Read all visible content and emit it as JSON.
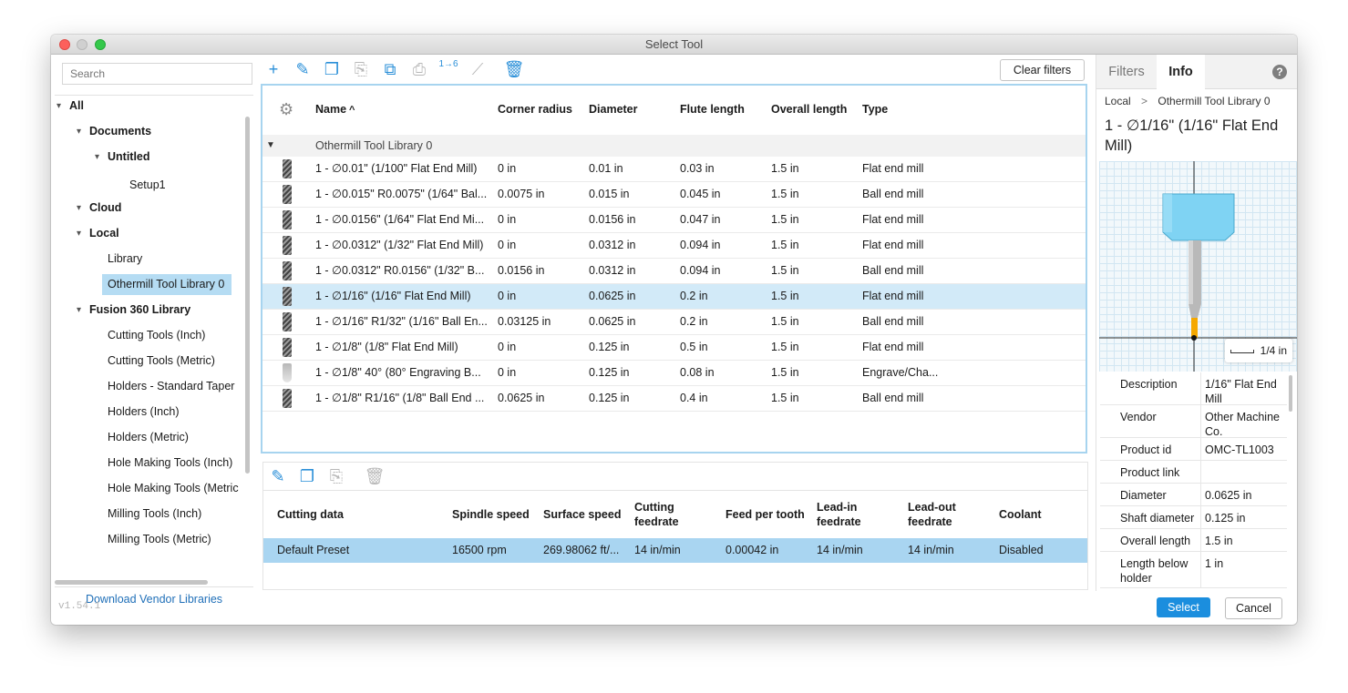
{
  "window": {
    "title": "Select Tool"
  },
  "sidebar": {
    "search_placeholder": "Search",
    "tree": [
      {
        "label": "All",
        "level": 0,
        "arrow": "▾",
        "bold": true
      },
      {
        "label": "Documents",
        "level": 1,
        "arrow": "▾",
        "bold": true
      },
      {
        "label": "Untitled",
        "level": 2,
        "arrow": "▾",
        "bold": true
      },
      {
        "label": "Setup1",
        "level": 3,
        "arrow": "",
        "bold": false
      },
      {
        "label": "Cloud",
        "level": 1,
        "arrow": "▾",
        "bold": true
      },
      {
        "label": "Local",
        "level": 1,
        "arrow": "▾",
        "bold": true
      },
      {
        "label": "Library",
        "level": 2,
        "arrow": "",
        "bold": false
      },
      {
        "label": "Othermill Tool Library 0",
        "level": 2,
        "arrow": "",
        "bold": false,
        "selected": true
      },
      {
        "label": "Fusion 360 Library",
        "level": 1,
        "arrow": "▾",
        "bold": true
      },
      {
        "label": "Cutting Tools (Inch)",
        "level": 2,
        "arrow": "",
        "bold": false
      },
      {
        "label": "Cutting Tools (Metric)",
        "level": 2,
        "arrow": "",
        "bold": false
      },
      {
        "label": "Holders - Standard Taper",
        "level": 2,
        "arrow": "",
        "bold": false
      },
      {
        "label": "Holders (Inch)",
        "level": 2,
        "arrow": "",
        "bold": false
      },
      {
        "label": "Holders (Metric)",
        "level": 2,
        "arrow": "",
        "bold": false
      },
      {
        "label": "Hole Making Tools (Inch)",
        "level": 2,
        "arrow": "",
        "bold": false
      },
      {
        "label": "Hole Making Tools (Metric",
        "level": 2,
        "arrow": "",
        "bold": false
      },
      {
        "label": "Milling Tools (Inch)",
        "level": 2,
        "arrow": "",
        "bold": false
      },
      {
        "label": "Milling Tools (Metric)",
        "level": 2,
        "arrow": "",
        "bold": false
      }
    ],
    "download_link": "Download Vendor Libraries",
    "version": "v1.54.1"
  },
  "toolbar": {
    "clear_filters": "Clear filters",
    "icons": [
      {
        "name": "add-icon",
        "glyph": "+",
        "enabled": true
      },
      {
        "name": "edit-icon",
        "glyph": "✎",
        "enabled": true
      },
      {
        "name": "copy-icon",
        "glyph": "❐",
        "enabled": true
      },
      {
        "name": "paste-icon",
        "glyph": "⎘",
        "enabled": false
      },
      {
        "name": "duplicate-icon",
        "glyph": "⧉",
        "enabled": true
      },
      {
        "name": "print-icon",
        "glyph": "⎙",
        "enabled": false
      },
      {
        "name": "renumber-icon",
        "glyph": "1→6",
        "enabled": true
      },
      {
        "name": "measure-icon",
        "glyph": "⟋",
        "enabled": false
      },
      {
        "name": "delete-icon",
        "glyph": "🗑",
        "enabled": true
      }
    ]
  },
  "tool_table": {
    "columns": [
      "Name",
      "Corner radius",
      "Diameter",
      "Flute length",
      "Overall length",
      "Type"
    ],
    "sort_indicator": "^",
    "group": "Othermill Tool Library 0",
    "rows": [
      {
        "icon": "flat",
        "name": "1 - ∅0.01\" (1/100\" Flat End Mill)",
        "corner_radius": "0 in",
        "diameter": "0.01 in",
        "flute_length": "0.03 in",
        "overall_length": "1.5 in",
        "type": "Flat end mill"
      },
      {
        "icon": "ball",
        "name": "1 - ∅0.015\" R0.0075\" (1/64\" Bal...",
        "corner_radius": "0.0075 in",
        "diameter": "0.015 in",
        "flute_length": "0.045 in",
        "overall_length": "1.5 in",
        "type": "Ball end mill"
      },
      {
        "icon": "flat",
        "name": "1 - ∅0.0156\" (1/64\" Flat End Mi...",
        "corner_radius": "0 in",
        "diameter": "0.0156 in",
        "flute_length": "0.047 in",
        "overall_length": "1.5 in",
        "type": "Flat end mill"
      },
      {
        "icon": "flat",
        "name": "1 - ∅0.0312\" (1/32\" Flat End Mill)",
        "corner_radius": "0 in",
        "diameter": "0.0312 in",
        "flute_length": "0.094 in",
        "overall_length": "1.5 in",
        "type": "Flat end mill"
      },
      {
        "icon": "ball",
        "name": "1 - ∅0.0312\" R0.0156\" (1/32\" B...",
        "corner_radius": "0.0156 in",
        "diameter": "0.0312 in",
        "flute_length": "0.094 in",
        "overall_length": "1.5 in",
        "type": "Ball end mill"
      },
      {
        "icon": "flat",
        "name": "1 - ∅1/16\" (1/16\" Flat End Mill)",
        "corner_radius": "0 in",
        "diameter": "0.0625 in",
        "flute_length": "0.2 in",
        "overall_length": "1.5 in",
        "type": "Flat end mill",
        "selected": true
      },
      {
        "icon": "ball",
        "name": "1 - ∅1/16\" R1/32\" (1/16\" Ball En...",
        "corner_radius": "0.03125 in",
        "diameter": "0.0625 in",
        "flute_length": "0.2 in",
        "overall_length": "1.5 in",
        "type": "Ball end mill"
      },
      {
        "icon": "flat",
        "name": "1 - ∅1/8\" (1/8\" Flat End Mill)",
        "corner_radius": "0 in",
        "diameter": "0.125 in",
        "flute_length": "0.5 in",
        "overall_length": "1.5 in",
        "type": "Flat end mill"
      },
      {
        "icon": "engrave",
        "name": "1 - ∅1/8\" 40° (80° Engraving B...",
        "corner_radius": "0 in",
        "diameter": "0.125 in",
        "flute_length": "0.08 in",
        "overall_length": "1.5 in",
        "type": "Engrave/Cha..."
      },
      {
        "icon": "ball",
        "name": "1 - ∅1/8\" R1/16\" (1/8\" Ball End ...",
        "corner_radius": "0.0625 in",
        "diameter": "0.125 in",
        "flute_length": "0.4 in",
        "overall_length": "1.5 in",
        "type": "Ball end mill"
      }
    ]
  },
  "cutting_toolbar": {
    "icons": [
      {
        "name": "edit-icon",
        "glyph": "✎",
        "enabled": true
      },
      {
        "name": "copy-icon",
        "glyph": "❐",
        "enabled": true
      },
      {
        "name": "paste-icon",
        "glyph": "⎘",
        "enabled": false
      },
      {
        "name": "delete-icon",
        "glyph": "🗑",
        "enabled": false
      }
    ]
  },
  "cutting_table": {
    "columns": [
      "Cutting data",
      "Spindle speed",
      "Surface speed",
      "Cutting\nfeedrate",
      "Feed per tooth",
      "Lead-in\nfeedrate",
      "Lead-out\nfeedrate",
      "Coolant"
    ],
    "rows": [
      {
        "cells": [
          "Default Preset",
          "16500 rpm",
          "269.98062 ft/...",
          "14 in/min",
          "0.00042 in",
          "14 in/min",
          "14 in/min",
          "Disabled"
        ]
      }
    ]
  },
  "info_panel": {
    "tabs": [
      "Filters",
      "Info"
    ],
    "active_tab": "Info",
    "help": "?",
    "breadcrumb": [
      "Local",
      "Othermill Tool Library 0"
    ],
    "breadcrumb_sep": ">",
    "title": "1 - ∅1/16\" (1/16\" Flat End Mill)",
    "scale_label": "1/4 in",
    "properties": [
      {
        "key": "Description",
        "value": "1/16\" Flat End Mill"
      },
      {
        "key": "Vendor",
        "value": "Other Machine Co."
      },
      {
        "key": "Product id",
        "value": "OMC-TL1003"
      },
      {
        "key": "Product link",
        "value": ""
      },
      {
        "key": "Diameter",
        "value": "0.0625 in"
      },
      {
        "key": "Shaft diameter",
        "value": "0.125 in"
      },
      {
        "key": "Overall length",
        "value": "1.5 in"
      },
      {
        "key": "Length below holder",
        "value": "1 in"
      }
    ]
  },
  "footer": {
    "select": "Select",
    "cancel": "Cancel"
  },
  "colors": {
    "accent": "#1b8ede",
    "selection": "#d2eaf8",
    "table_focus": "#a7d4ef",
    "holder": "#7fd3f3",
    "tool_tip": "#f5a800"
  }
}
